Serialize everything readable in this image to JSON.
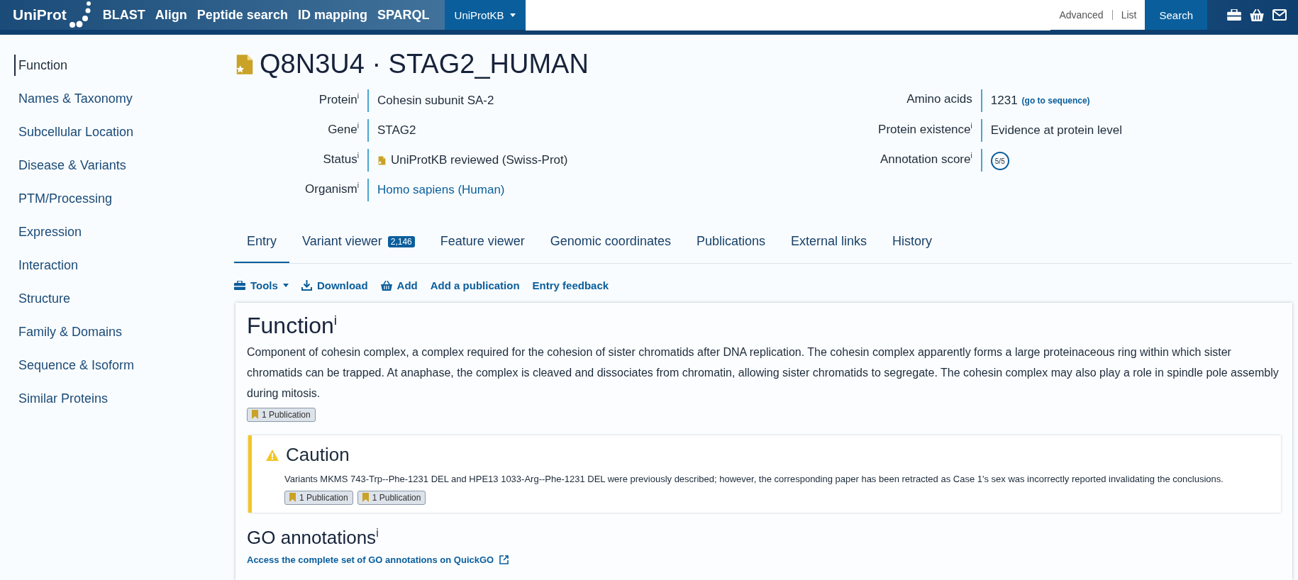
{
  "header": {
    "logo": "UniProt",
    "nav": [
      "BLAST",
      "Align",
      "Peptide search",
      "ID mapping",
      "SPARQL"
    ],
    "database": "UniProtKB",
    "links": [
      "Advanced",
      "List"
    ],
    "search_button": "Search"
  },
  "sidebar": {
    "items": [
      {
        "label": "Function",
        "selected": true
      },
      {
        "label": "Names & Taxonomy",
        "selected": false
      },
      {
        "label": "Subcellular Location",
        "selected": false
      },
      {
        "label": "Disease & Variants",
        "selected": false
      },
      {
        "label": "PTM/Processing",
        "selected": false
      },
      {
        "label": "Expression",
        "selected": false
      },
      {
        "label": "Interaction",
        "selected": false
      },
      {
        "label": "Structure",
        "selected": false
      },
      {
        "label": "Family & Domains",
        "selected": false
      },
      {
        "label": "Sequence & Isoform",
        "selected": false
      },
      {
        "label": "Similar Proteins",
        "selected": false
      }
    ]
  },
  "entry": {
    "title": "Q8N3U4 · STAG2_HUMAN",
    "left_fields": [
      {
        "label": "Protein$^{i}$",
        "value": "Cohesin subunit SA-2",
        "kind": "text"
      },
      {
        "label": "Gene$^{i}$",
        "value": "STAG2",
        "kind": "text"
      },
      {
        "label": "Status$^{i}$",
        "value": "UniProtKB reviewed (Swiss-Prot)",
        "kind": "status"
      },
      {
        "label": "Organism$^{i}$",
        "value": "Homo sapiens (Human)",
        "kind": "link"
      }
    ],
    "right_fields": [
      {
        "label": "Amino acids",
        "value": "1231",
        "link": "(go to sequence)",
        "kind": "sequence"
      },
      {
        "label": "Protein existence$^{i}$",
        "value": "Evidence at protein level",
        "kind": "plain"
      },
      {
        "label": "Annotation score$^{i}$",
        "value": "5/5",
        "kind": "score"
      }
    ]
  },
  "tabs": [
    {
      "label": "Entry",
      "selected": true
    },
    {
      "label": "Variant viewer",
      "badge": "2,146",
      "selected": false
    },
    {
      "label": "Feature viewer",
      "selected": false
    },
    {
      "label": "Genomic coordinates",
      "selected": false
    },
    {
      "label": "Publications",
      "selected": false
    },
    {
      "label": "External links",
      "selected": false
    },
    {
      "label": "History",
      "selected": false
    }
  ],
  "toolbar": [
    {
      "label": "Tools",
      "kind": "tools"
    },
    {
      "label": "Download",
      "kind": "download"
    },
    {
      "label": "Add",
      "kind": "basket"
    },
    {
      "label": "Add a publication",
      "kind": "plain"
    },
    {
      "label": "Entry feedback",
      "kind": "plain"
    }
  ],
  "function": {
    "heading": "Function$^{i}$",
    "text": "Component of cohesin complex, a complex required for the cohesion of sister chromatids after DNA replication. The cohesin complex apparently forms a large proteinaceous ring within which sister chromatids can be trapped. At anaphase, the complex is cleaved and dissociates from chromatin, allowing sister chromatids to segregate. The cohesin complex may also play a role in spindle pole assembly during mitosis.",
    "publications": [
      "1 Publication"
    ],
    "caution": {
      "heading": "Caution",
      "text": "Variants MKMS 743-Trp--Phe-1231 DEL and HPE13 1033-Arg--Phe-1231 DEL were previously described; however, the corresponding paper has been retracted as Case 1's sex was incorrectly reported invalidating the conclusions.",
      "publications": [
        "1 Publication",
        "1 Publication"
      ]
    },
    "go_heading": "GO annotations$^{i}$",
    "go_link": "Access the complete set of GO annotations on QuickGO"
  }
}
